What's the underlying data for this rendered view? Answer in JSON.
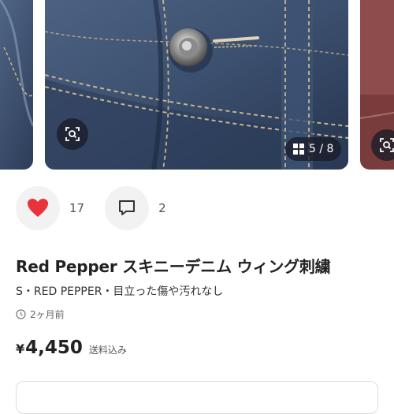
{
  "gallery": {
    "prev_counter": "/ 8",
    "main_counter": "5 / 8"
  },
  "actions": {
    "like_count": "17",
    "comment_count": "2"
  },
  "item": {
    "title": "Red Pepper スキニーデニム ウィング刺繍",
    "subtitle": "S・RED PEPPER・目立った傷や汚れなし",
    "posted": "2ヶ月前",
    "currency": "¥",
    "price": "4,450",
    "shipping_note": "送料込み"
  },
  "colors": {
    "like_heart": "#e8333b",
    "denim": "#3d5270"
  }
}
